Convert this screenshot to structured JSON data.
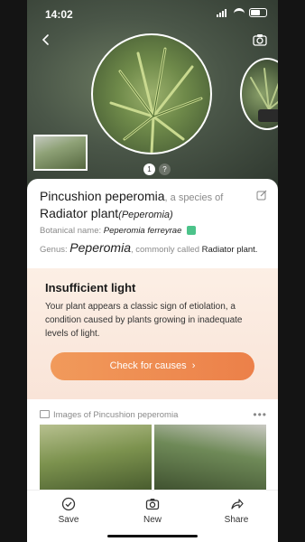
{
  "status_bar": {
    "time": "14:02"
  },
  "pager": {
    "current": "1",
    "other": "?"
  },
  "plant": {
    "name": "Pincushion peperomia",
    "species_connector": ", a species of",
    "species_name": "Radiator plant",
    "species_latin": "(Peperomia)",
    "botanical_label": "Botanical name:",
    "botanical_value": "Peperomia ferreyrae",
    "genus_label": "Genus:",
    "genus_value": "Peperomia",
    "genus_connector": ", commonly called",
    "genus_common": "Radiator plant."
  },
  "alert": {
    "title": "Insufficient light",
    "body": "Your plant appears a classic sign of etiolation, a condition caused by plants growing in inadequate levels of light.",
    "button_label": "Check for causes"
  },
  "gallery": {
    "title": "Images of Pincushion peperomia",
    "more": "•••"
  },
  "tabbar": {
    "save": "Save",
    "new": "New",
    "share": "Share"
  },
  "colors": {
    "accent": "#ec8049",
    "alert_bg": "#fcefe5",
    "badge": "#4cc38a"
  },
  "icons": [
    "back-arrow-icon",
    "camera-icon",
    "edit-icon",
    "image-icon",
    "more-icon",
    "checkmark-circle-icon",
    "share-icon"
  ]
}
